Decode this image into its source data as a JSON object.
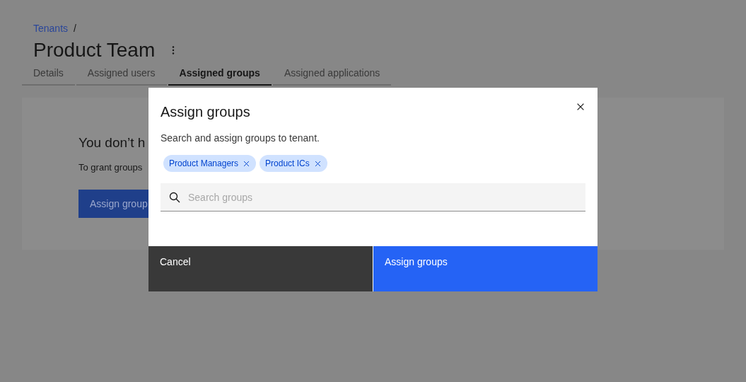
{
  "breadcrumb": {
    "link": "Tenants",
    "separator": "/"
  },
  "page_title": "Product Team",
  "tabs": [
    {
      "label": "Details",
      "selected": false
    },
    {
      "label": "Assigned users",
      "selected": false
    },
    {
      "label": "Assigned groups",
      "selected": true
    },
    {
      "label": "Assigned applications",
      "selected": false
    }
  ],
  "empty_state": {
    "heading": "You don’t h",
    "text": "To grant groups",
    "button": "Assign group"
  },
  "modal": {
    "title": "Assign groups",
    "description": "Search and assign groups to tenant.",
    "tags": [
      {
        "label": "Product Managers"
      },
      {
        "label": "Product ICs"
      }
    ],
    "search": {
      "placeholder": "Search groups"
    },
    "buttons": [
      {
        "kind": "secondary",
        "label": "Cancel"
      },
      {
        "kind": "primary",
        "label": "Assign groups"
      }
    ]
  }
}
